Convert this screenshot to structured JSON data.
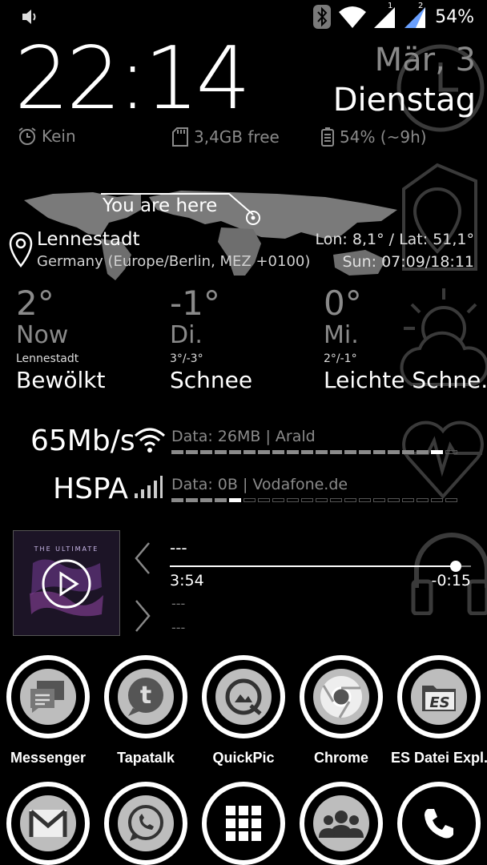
{
  "status_bar": {
    "battery_percent": "54%",
    "icons": [
      "volume-icon",
      "bluetooth-icon",
      "wifi-icon",
      "signal-icon-1",
      "signal-icon-2"
    ],
    "sim1_label": "1",
    "sim2_label": "2"
  },
  "clock": {
    "time": "22:14",
    "date": "Mär, 3",
    "weekday": "Dienstag"
  },
  "info": {
    "alarm": "Kein",
    "storage": "3,4GB free",
    "battery": "54% (~9h)"
  },
  "location": {
    "you_are_here": "You are here",
    "city": "Lennestadt",
    "region": "Germany (Europe/Berlin, MEZ +0100)",
    "coords": "Lon: 8,1° / Lat: 51,1°",
    "sun": "Sun: 07:09/18:11"
  },
  "weather": [
    {
      "temp": "2°",
      "day": "Now",
      "sub": "Lennestadt",
      "cond": "Bewölkt"
    },
    {
      "temp": "-1°",
      "day": "Di.",
      "sub": "3°/-3°",
      "cond": "Schnee"
    },
    {
      "temp": "0°",
      "day": "Mi.",
      "sub": "2°/-1°",
      "cond": "Leichte Schne..."
    }
  ],
  "network": {
    "wifi_speed": "65Mb/s",
    "wifi_data": "Data: 26MB | Arald",
    "wifi_level": 0.93,
    "mobile_type": "HSPA",
    "mobile_data": "Data: 0B | Vodafone.de",
    "mobile_level": 0.25
  },
  "music": {
    "title": "---",
    "elapsed": "3:54",
    "remaining": "-0:15",
    "progress": 0.95,
    "artist": "---",
    "album": "---",
    "album_text": "THE ULTIMATE"
  },
  "apps_row1": [
    {
      "label": "Messenger",
      "icon": "messenger-icon"
    },
    {
      "label": "Tapatalk",
      "icon": "tapatalk-icon"
    },
    {
      "label": "QuickPic",
      "icon": "quickpic-icon"
    },
    {
      "label": "Chrome",
      "icon": "chrome-icon"
    },
    {
      "label": "ES Datei Expl...",
      "icon": "es-file-explorer-icon"
    }
  ],
  "apps_row2": [
    {
      "icon": "gmail-icon"
    },
    {
      "icon": "whatsapp-icon"
    },
    {
      "icon": "app-drawer-icon"
    },
    {
      "icon": "contacts-icon"
    },
    {
      "icon": "phone-icon"
    }
  ]
}
